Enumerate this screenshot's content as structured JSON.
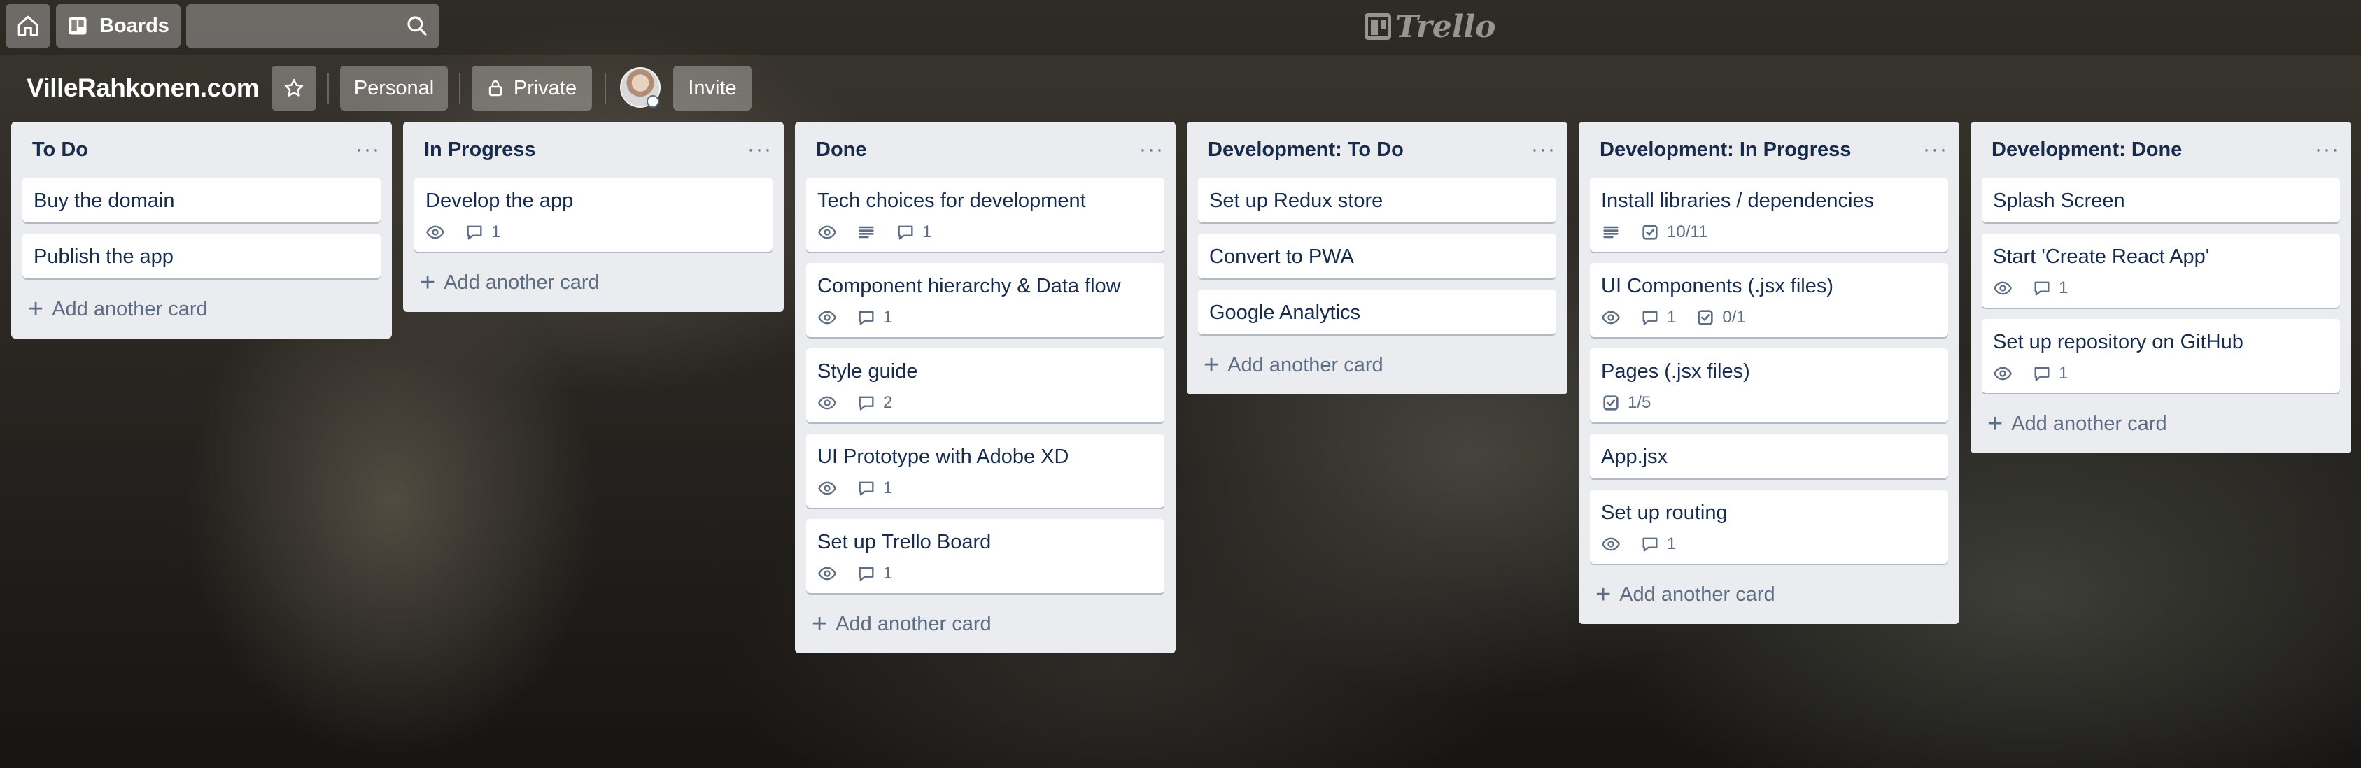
{
  "topbar": {
    "boards_label": "Boards",
    "logo_text": "Trello"
  },
  "board": {
    "title": "VilleRahkonen.com",
    "team_label": "Personal",
    "visibility_label": "Private",
    "invite_label": "Invite"
  },
  "add_card_label": "Add another card",
  "lists": [
    {
      "title": "To Do",
      "cards": [
        {
          "title": "Buy the domain"
        },
        {
          "title": "Publish the app"
        }
      ]
    },
    {
      "title": "In Progress",
      "cards": [
        {
          "title": "Develop the app",
          "comments": "1"
        }
      ]
    },
    {
      "title": "Done",
      "cards": [
        {
          "title": "Tech choices for development",
          "comments": "1"
        },
        {
          "title": "Component hierarchy & Data flow",
          "comments": "1"
        },
        {
          "title": "Style guide",
          "comments": "2"
        },
        {
          "title": "UI Prototype with Adobe XD",
          "comments": "1"
        },
        {
          "title": "Set up Trello Board",
          "comments": "1"
        }
      ]
    },
    {
      "title": "Development: To Do",
      "cards": [
        {
          "title": "Set up Redux store"
        },
        {
          "title": "Convert to PWA"
        },
        {
          "title": "Google Analytics"
        }
      ]
    },
    {
      "title": "Development: In Progress",
      "cards": [
        {
          "title": "Install libraries / dependencies",
          "checklist": "10/11"
        },
        {
          "title": "UI Components (.jsx files)",
          "comments": "1",
          "checklist": "0/1"
        },
        {
          "title": "Pages (.jsx files)",
          "checklist": "1/5"
        },
        {
          "title": "App.jsx"
        },
        {
          "title": "Set up routing",
          "comments": "1"
        }
      ]
    },
    {
      "title": "Development: Done",
      "cards": [
        {
          "title": "Splash Screen"
        },
        {
          "title": "Start 'Create React App'",
          "comments": "1"
        },
        {
          "title": "Set up repository on GitHub",
          "comments": "1"
        }
      ]
    }
  ]
}
